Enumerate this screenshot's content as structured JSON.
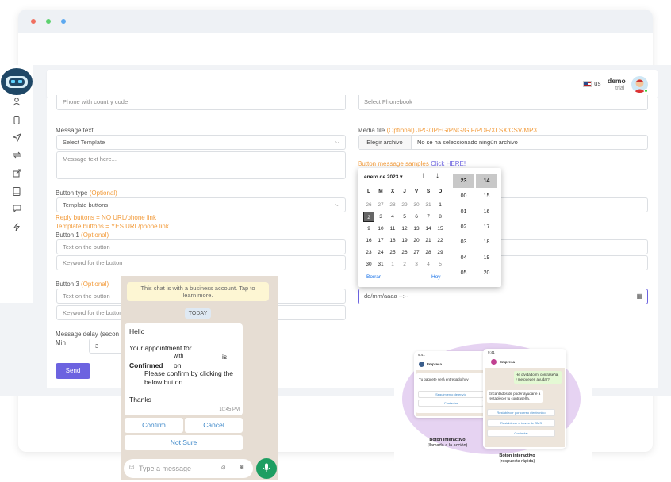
{
  "header": {
    "lang": "us",
    "user_name": "demo",
    "user_role": "trial"
  },
  "form": {
    "phone_placeholder": "Phone with country code",
    "phonebook_placeholder": "Select Phonebook",
    "message_text_label": "Message text",
    "template_select": "Select Template",
    "message_text_placeholder": "Message text here...",
    "media_file_label": "Media file",
    "media_file_hint": "(Optional) JPG/JPEG/PNG/GIF/PDF/XLSX/CSV/MP3",
    "choose_file": "Elegir archivo",
    "no_file": "No se ha seleccionado ningún archivo",
    "button_samples": "Button message samples",
    "click_here": "Click HERE!",
    "button_type_label": "Button type",
    "optional": "(Optional)",
    "button_type_value": "Template buttons",
    "reply_note": "Reply buttons = NO URL/phone link",
    "template_note": "Template buttons = YES URL/phone link",
    "button1_label": "Button 1",
    "button_text_placeholder": "Text on the button",
    "keyword_placeholder": "Keyword for the button",
    "button3_label": "Button 3",
    "delay_label": "Message delay (secon",
    "min_label": "Min",
    "min_value": "3",
    "date_value": "dd/mm/aaaa --:--",
    "send": "Send"
  },
  "calendar": {
    "month": "enero de 2023",
    "dow": [
      "L",
      "M",
      "X",
      "J",
      "V",
      "S",
      "D"
    ],
    "weeks": [
      [
        "26",
        "27",
        "28",
        "29",
        "30",
        "31",
        "1"
      ],
      [
        "2",
        "3",
        "4",
        "5",
        "6",
        "7",
        "8"
      ],
      [
        "9",
        "10",
        "11",
        "12",
        "13",
        "14",
        "15"
      ],
      [
        "16",
        "17",
        "18",
        "19",
        "20",
        "21",
        "22"
      ],
      [
        "23",
        "24",
        "25",
        "26",
        "27",
        "28",
        "29"
      ],
      [
        "30",
        "31",
        "1",
        "2",
        "3",
        "4",
        "5"
      ]
    ],
    "hours": [
      "23",
      "00",
      "01",
      "02",
      "03",
      "04",
      "05"
    ],
    "minutes": [
      "14",
      "15",
      "16",
      "17",
      "18",
      "19",
      "20"
    ],
    "clear": "Borrar",
    "today": "Hoy"
  },
  "chat": {
    "system": "This chat is with a business account. Tap to learn more.",
    "today": "TODAY",
    "hello": "Hello",
    "line1": "Your appointment for",
    "with": "with",
    "is": "is",
    "confirmed": "Confirmed",
    "on": "on",
    "please": "Please confirm by clicking the below button",
    "thanks": "Thanks",
    "time": "10:45 PM",
    "confirm": "Confirm",
    "cancel": "Cancel",
    "not_sure": "Not Sure",
    "input_placeholder": "Type a message"
  },
  "promo": {
    "phone1": {
      "time": "9:41",
      "name": "Empresa",
      "msg": "Tu paquete será entregado hoy",
      "btn1": "Seguimiento de envío",
      "btn2": "Contactar",
      "caption_bold": "Botón interactivo",
      "caption": "(llamada a la acción)"
    },
    "phone2": {
      "time": "9:41",
      "name": "Empresa",
      "user_msg": "He olvidado mi contraseña, ¿me pueden ayudar?",
      "reply": "Encantados de poder ayudarte a restablecer tu contraseña.",
      "btn1": "Restablecer por correo electrónico",
      "btn2": "Restablecer a través de SMS",
      "btn3": "Contactar",
      "caption_bold": "Botón interactivo",
      "caption": "(respuesta rápida)"
    }
  },
  "colors": {
    "accent": "#6c63e0",
    "orange": "#f29b3b",
    "whatsapp_green": "#1e9e62",
    "promo_blob": "#e6d3f2"
  }
}
